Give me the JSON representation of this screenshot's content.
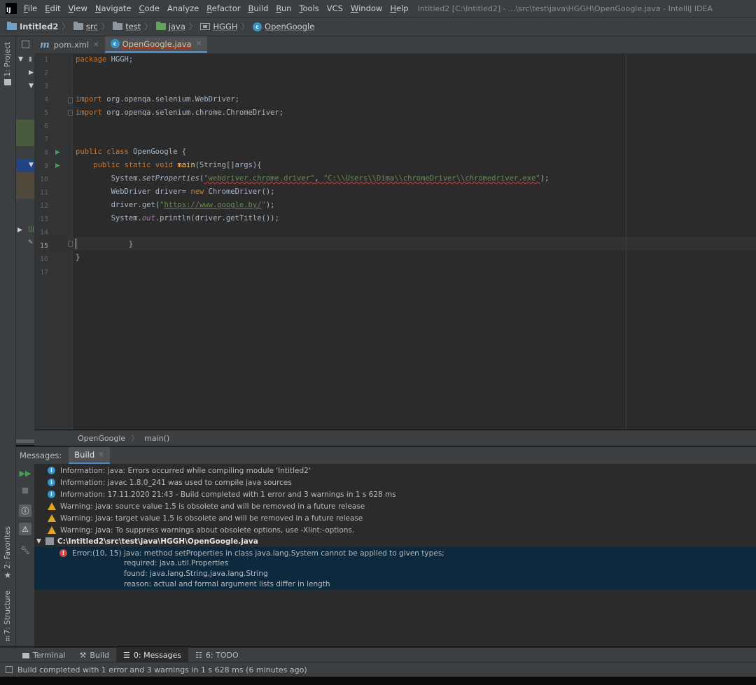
{
  "menu": {
    "app_icon": "IJ",
    "items": [
      {
        "u": "F",
        "rest": "ile"
      },
      {
        "u": "E",
        "rest": "dit"
      },
      {
        "u": "V",
        "rest": "iew"
      },
      {
        "u": "N",
        "rest": "avigate"
      },
      {
        "u": "C",
        "rest": "ode"
      },
      {
        "u": "",
        "rest": "Analyze"
      },
      {
        "u": "R",
        "rest": "efactor"
      },
      {
        "u": "B",
        "rest": "uild"
      },
      {
        "u": "R",
        "rest": "un"
      },
      {
        "u": "T",
        "rest": "ools"
      },
      {
        "u": "",
        "rest": "VCS"
      },
      {
        "u": "W",
        "rest": "indow"
      },
      {
        "u": "H",
        "rest": "elp"
      }
    ],
    "window_title": "Intitled2 [C:\\Intitled2] - ...\\src\\test\\java\\HGGH\\OpenGoogle.java - IntelliJ IDEA"
  },
  "breadcrumbs": {
    "project": "Intitled2",
    "src": "src",
    "test": "test",
    "java": "java",
    "package": "HGGH",
    "class": "OpenGoogle"
  },
  "tool_stripe": {
    "project": "1: Project",
    "favorites": "2: Favorites",
    "structure": "7: Structure"
  },
  "tabs": {
    "pom": "pom.xml",
    "active": "OpenGoogle.java",
    "m_icon": "m",
    "c_icon": "c"
  },
  "editor": {
    "line_numbers": [
      "1",
      "2",
      "3",
      "4",
      "5",
      "6",
      "7",
      "8",
      "9",
      "10",
      "11",
      "12",
      "13",
      "14",
      "15",
      "16",
      "17"
    ],
    "code": {
      "l1_kw": "package",
      "l1_rest": " HGGH;",
      "l4_kw": "import",
      "l4_rest": " org.openqa.selenium.WebDriver;",
      "l5_kw": "import",
      "l5_rest": " org.openqa.selenium.chrome.ChromeDriver;",
      "l8_kw": "public class",
      "l8_rest": " OpenGoogle {",
      "l9_kw": "    public static void",
      "l9_fn": " main",
      "l9_rest": "(String[]args){",
      "l10_a": "        System.",
      "l10_m": "setProperties",
      "l10_b": "(",
      "l10_s1": "\"webdriver.chrome.driver\"",
      "l10_c": ", ",
      "l10_s2": "\"C:\\\\Users\\\\Dima\\\\chromeDriver\\\\chromedriver.exe\"",
      "l10_d": ");",
      "l11_a": "        WebDriver driver= ",
      "l11_kw": "new",
      "l11_b": " ChromeDriver();",
      "l12_a": "        driver.get(",
      "l12_q1": "\"",
      "l12_url": "https://www.google.by/",
      "l12_q2": "\"",
      "l12_b": ");",
      "l13_a": "        System.",
      "l13_out": "out",
      "l13_b": ".println(driver.getTitle());",
      "l15": "            }",
      "l16": "}"
    }
  },
  "editor_crumbs": {
    "class": "OpenGoogle",
    "method": "main()"
  },
  "messages": {
    "label": "Messages:",
    "tab": "Build",
    "rows": [
      {
        "type": "info",
        "text": "Information: java: Errors occurred while compiling module 'Intitled2'"
      },
      {
        "type": "info",
        "text": "Information: javac 1.8.0_241 was used to compile java sources"
      },
      {
        "type": "info",
        "text": "Information: 17.11.2020 21:43 - Build completed with 1 error and 3 warnings in 1 s 628 ms"
      },
      {
        "type": "warning",
        "text": "Warning: java: source value 1.5 is obsolete and will be removed in a future release"
      },
      {
        "type": "warning",
        "text": "Warning: java: target value 1.5 is obsolete and will be removed in a future release"
      },
      {
        "type": "warning",
        "text": "Warning: java: To suppress warnings about obsolete options, use -Xlint:-options."
      }
    ],
    "file": "C:\\Intitled2\\src\\test\\java\\HGGH\\OpenGoogle.java",
    "error": {
      "line": "Error:(10, 15)  java: method setProperties in class java.lang.System cannot be applied to given types;",
      "required": "required: java.util.Properties",
      "found": "found: java.lang.String,java.lang.String",
      "reason": "reason: actual and formal argument lists differ in length"
    }
  },
  "bottom_tabs": {
    "terminal": "Terminal",
    "build": "Build",
    "messages": "0: Messages",
    "todo": "6: TODO"
  },
  "status": {
    "text": "Build completed with 1 error and 3 warnings in 1 s 628 ms (6 minutes ago)"
  },
  "colors": {
    "keyword": "#cc7832",
    "string": "#6a8759",
    "error_selection": "#0d293e",
    "accent": "#4a88c7"
  }
}
